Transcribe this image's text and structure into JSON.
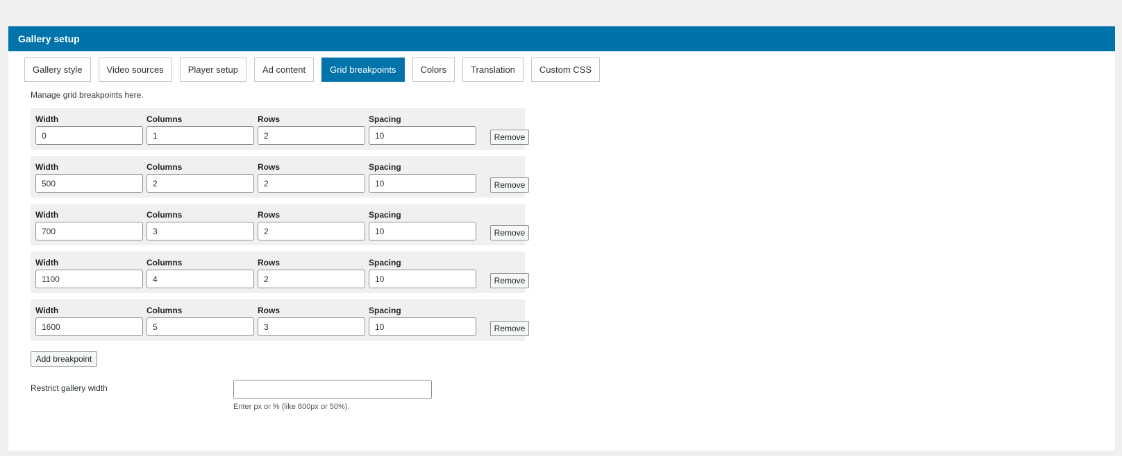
{
  "panel": {
    "title": "Gallery setup",
    "accent_color": "#0073aa"
  },
  "tabs": [
    {
      "label": "Gallery style",
      "active": false
    },
    {
      "label": "Video sources",
      "active": false
    },
    {
      "label": "Player setup",
      "active": false
    },
    {
      "label": "Ad content",
      "active": false
    },
    {
      "label": "Grid breakpoints",
      "active": true
    },
    {
      "label": "Colors",
      "active": false
    },
    {
      "label": "Translation",
      "active": false
    },
    {
      "label": "Custom CSS",
      "active": false
    }
  ],
  "grid": {
    "intro": "Manage grid breakpoints here.",
    "labels": {
      "width": "Width",
      "columns": "Columns",
      "rows": "Rows",
      "spacing": "Spacing",
      "remove": "Remove"
    },
    "breakpoints": [
      {
        "width": "0",
        "columns": "1",
        "rows": "2",
        "spacing": "10"
      },
      {
        "width": "500",
        "columns": "2",
        "rows": "2",
        "spacing": "10"
      },
      {
        "width": "700",
        "columns": "3",
        "rows": "2",
        "spacing": "10"
      },
      {
        "width": "1100",
        "columns": "4",
        "rows": "2",
        "spacing": "10"
      },
      {
        "width": "1600",
        "columns": "5",
        "rows": "3",
        "spacing": "10"
      }
    ],
    "add_label": "Add breakpoint"
  },
  "restrict": {
    "label": "Restrict gallery width",
    "value": "",
    "help": "Enter px or % (like 600px or 50%)."
  }
}
